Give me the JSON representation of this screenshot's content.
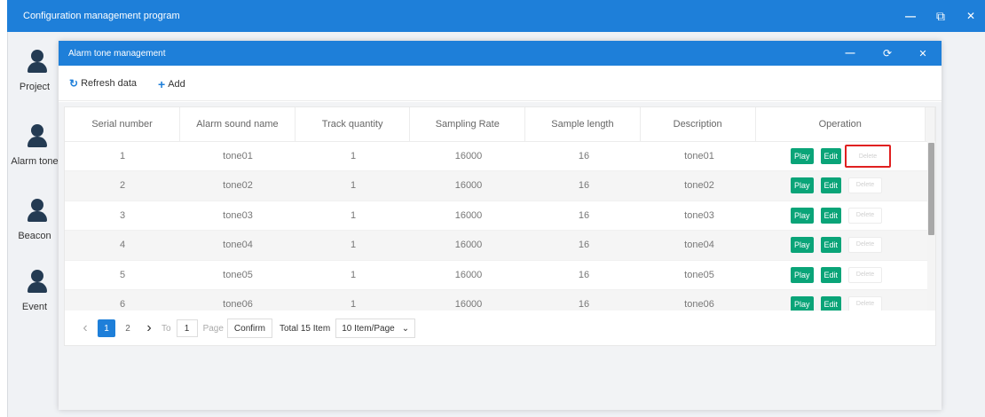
{
  "window": {
    "title": "Configuration management program",
    "minimize": "—",
    "restore": "⧉",
    "close": "✕"
  },
  "sidebar": {
    "items": [
      {
        "label": "Project",
        "icon": "user-icon"
      },
      {
        "label": "Alarm tone",
        "icon": "user-icon"
      },
      {
        "label": "Beacon",
        "icon": "user-icon"
      },
      {
        "label": "Event",
        "icon": "user-icon"
      }
    ]
  },
  "dialog": {
    "title": "Alarm tone management",
    "minimize": "—",
    "restore": "⟳",
    "close": "✕"
  },
  "toolbar": {
    "refresh_icon": "↻",
    "refresh_label": "Refresh data",
    "add_icon": "+",
    "add_label": "Add"
  },
  "table": {
    "columns": [
      "Serial number",
      "Alarm sound name",
      "Track quantity",
      "Sampling Rate",
      "Sample length",
      "Description",
      "Operation"
    ],
    "rows": [
      {
        "serial": "1",
        "name": "tone01",
        "tracks": "1",
        "rate": "16000",
        "length": "16",
        "description": "tone01",
        "play": "Play",
        "edit": "Edit",
        "delete": "Delete"
      },
      {
        "serial": "2",
        "name": "tone02",
        "tracks": "1",
        "rate": "16000",
        "length": "16",
        "description": "tone02",
        "play": "Play",
        "edit": "Edit",
        "delete": "Delete"
      },
      {
        "serial": "3",
        "name": "tone03",
        "tracks": "1",
        "rate": "16000",
        "length": "16",
        "description": "tone03",
        "play": "Play",
        "edit": "Edit",
        "delete": "Delete"
      },
      {
        "serial": "4",
        "name": "tone04",
        "tracks": "1",
        "rate": "16000",
        "length": "16",
        "description": "tone04",
        "play": "Play",
        "edit": "Edit",
        "delete": "Delete"
      },
      {
        "serial": "5",
        "name": "tone05",
        "tracks": "1",
        "rate": "16000",
        "length": "16",
        "description": "tone05",
        "play": "Play",
        "edit": "Edit",
        "delete": "Delete"
      },
      {
        "serial": "6",
        "name": "tone06",
        "tracks": "1",
        "rate": "16000",
        "length": "16",
        "description": "tone06",
        "play": "Play",
        "edit": "Edit",
        "delete": "Delete"
      }
    ]
  },
  "pagination": {
    "prev": "‹",
    "pages": [
      "1",
      "2"
    ],
    "current_page": "1",
    "next": "›",
    "to_label": "To",
    "goto_value": "1",
    "page_label": "Page",
    "confirm_label": "Confirm",
    "total_label": "Total 15 Item",
    "per_page_label": "10 Item/Page",
    "per_page_arrow": "⌄"
  },
  "colors": {
    "header_blue": "#1e7fd9",
    "action_green": "#0aa478",
    "highlight_red": "#e02020"
  }
}
